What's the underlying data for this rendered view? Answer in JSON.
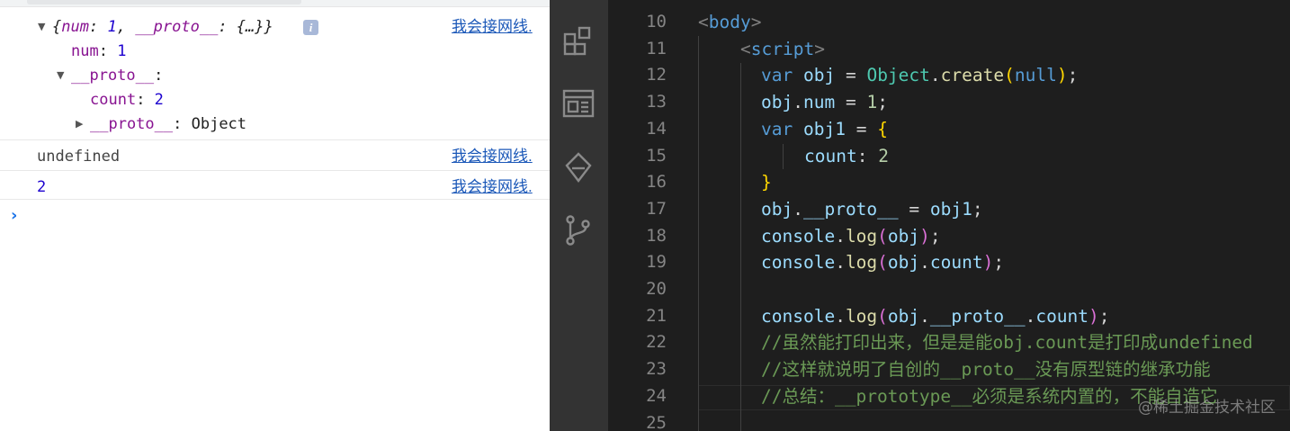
{
  "console": {
    "entries": [
      {
        "object_preview": {
          "open": "{",
          "k1": "num",
          "v1": "1",
          "k2": "__proto__",
          "v2": "{…}",
          "close": "}"
        },
        "info_badge": "i",
        "children": {
          "num_key": "num",
          "num_val": "1",
          "proto_key": "__proto__",
          "count_key": "count",
          "count_val": "2",
          "inner_proto_key": "__proto__",
          "inner_proto_val": "Object"
        },
        "source": "我会接网线."
      },
      {
        "text": "undefined",
        "source": "我会接网线."
      },
      {
        "text": "2",
        "source": "我会接网线."
      }
    ],
    "prompt_icon": "chevron-right-icon"
  },
  "editor": {
    "activity_bar": [
      "extensions-icon",
      "browser-preview-icon",
      "remote-explorer-icon",
      "source-control-icon"
    ],
    "line_numbers": [
      "10",
      "11",
      "12",
      "13",
      "14",
      "15",
      "16",
      "17",
      "18",
      "19",
      "20",
      "21",
      "22",
      "23",
      "24",
      "25"
    ],
    "code": {
      "l10": {
        "lt": "<",
        "tag": "body",
        "gt": ">"
      },
      "l11": {
        "lt": "<",
        "tag": "script",
        "gt": ">"
      },
      "l12": {
        "kw": "var",
        "name": "obj",
        "eq": " = ",
        "cls": "Object",
        "dot": ".",
        "fn": "create",
        "lp": "(",
        "arg": "null",
        "rp": ")",
        "semi": ";"
      },
      "l13": {
        "obj": "obj",
        "dot": ".",
        "prop": "num",
        "eq": " = ",
        "val": "1",
        "semi": ";"
      },
      "l14": {
        "kw": "var",
        "name": "obj1",
        "eq": " = ",
        "brace": "{"
      },
      "l15": {
        "key": "count",
        "colon": ": ",
        "val": "2"
      },
      "l16": {
        "brace": "}"
      },
      "l17": {
        "obj": "obj",
        "dot": ".",
        "prop": "__proto__",
        "eq": " = ",
        "val": "obj1",
        "semi": ";"
      },
      "l18": {
        "obj": "console",
        "dot": ".",
        "fn": "log",
        "lp": "(",
        "arg": "obj",
        "rp": ")",
        "semi": ";"
      },
      "l19": {
        "obj": "console",
        "dot": ".",
        "fn": "log",
        "lp": "(",
        "arg": "obj",
        "dot2": ".",
        "prop": "count",
        "rp": ")",
        "semi": ";"
      },
      "l21": {
        "obj": "console",
        "dot": ".",
        "fn": "log",
        "lp": "(",
        "arg": "obj",
        "dot2": ".",
        "prop": "__proto__",
        "dot3": ".",
        "prop2": "count",
        "rp": ")",
        "semi": ";"
      },
      "l22": "//虽然能打印出来，但是是能obj.count是打印成undefined",
      "l23": "//这样就说明了自创的__proto__没有原型链的继承功能",
      "l24": "//总结：__prototype__必须是系统内置的，不能自造它"
    },
    "watermark": "@稀土掘金技术社区"
  }
}
